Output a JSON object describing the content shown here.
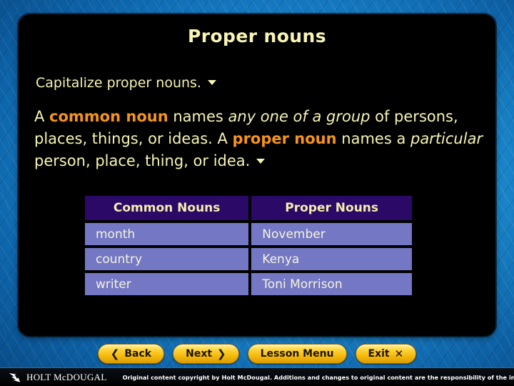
{
  "slide": {
    "title": "Proper nouns",
    "bullet": "Capitalize proper nouns.",
    "definition": {
      "seg1": "A ",
      "kw1": "common noun",
      "seg2": " names ",
      "it1": "any one of a group",
      "seg3": " of persons, places, things, or ideas. A ",
      "kw2": "proper noun",
      "seg4": " names a ",
      "it2": "particular",
      "seg5": " person, place, thing, or idea."
    }
  },
  "table": {
    "headers": [
      "Common Nouns",
      "Proper Nouns"
    ],
    "rows": [
      [
        "month",
        "November"
      ],
      [
        "country",
        "Kenya"
      ],
      [
        "writer",
        "Toni Morrison"
      ]
    ]
  },
  "nav": {
    "back_label": "Back",
    "back_icon": "chevron-left",
    "next_label": "Next",
    "next_icon": "chevron-right",
    "lesson_menu_label": "Lesson Menu",
    "exit_label": "Exit",
    "exit_icon": "close-x"
  },
  "footer": {
    "brand": "HOLT McDOUGAL",
    "copyright": "Original content copyright by Holt McDougal. Additions and changes to original content are the responsibility of the instructor."
  },
  "colors": {
    "title": "#f7f4b4",
    "keyword": "#f5941d",
    "table_header_bg": "#2a0a66",
    "table_row_bg": "#7478c4",
    "button": "#ffd43a",
    "background": "#1d8ccf"
  }
}
